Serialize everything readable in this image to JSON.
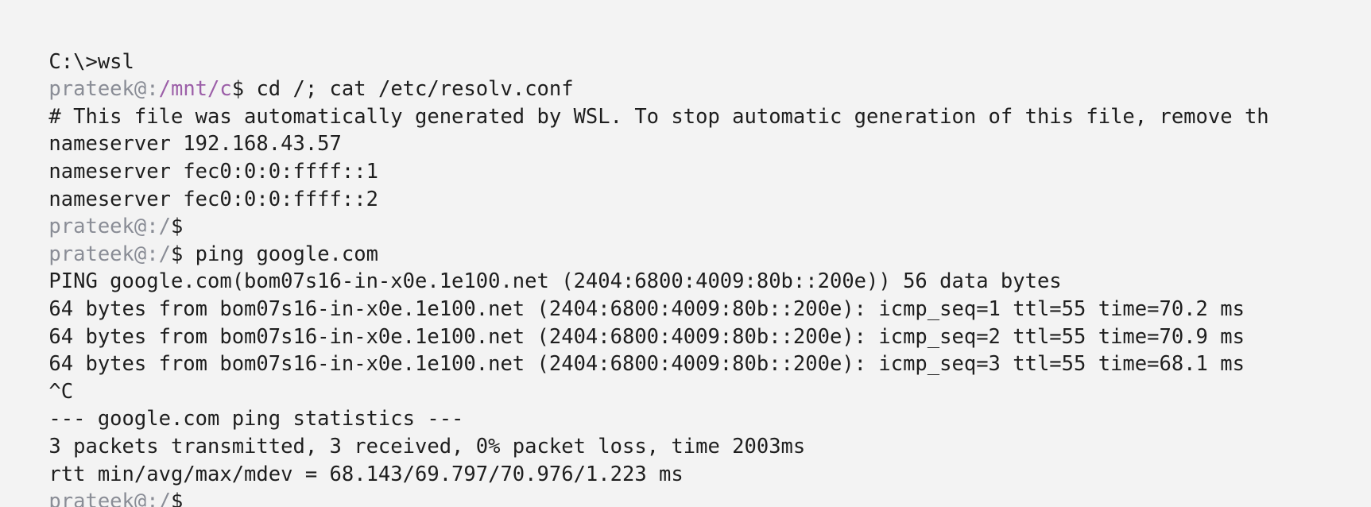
{
  "terminal": {
    "colors": {
      "background": "#f3f3f3",
      "text": "#1e1e1e",
      "prompt_user": "#8a8d96",
      "prompt_path": "#9c5fa8"
    },
    "lines": [
      {
        "type": "plain",
        "text": "C:\\>wsl"
      },
      {
        "type": "prompt",
        "user": "prateek",
        "at": "@:",
        "path": "/mnt/c",
        "sym": "$",
        "cmd": " cd /; cat /etc/resolv.conf"
      },
      {
        "type": "plain",
        "text": "# This file was automatically generated by WSL. To stop automatic generation of this file, remove th"
      },
      {
        "type": "plain",
        "text": "nameserver 192.168.43.57"
      },
      {
        "type": "plain",
        "text": "nameserver fec0:0:0:ffff::1"
      },
      {
        "type": "plain",
        "text": "nameserver fec0:0:0:ffff::2"
      },
      {
        "type": "prompt",
        "user": "prateek",
        "at": "@:",
        "path": "/",
        "sym": "$",
        "cmd": ""
      },
      {
        "type": "prompt",
        "user": "prateek",
        "at": "@:",
        "path": "/",
        "sym": "$",
        "cmd": " ping google.com"
      },
      {
        "type": "plain",
        "text": "PING google.com(bom07s16-in-x0e.1e100.net (2404:6800:4009:80b::200e)) 56 data bytes"
      },
      {
        "type": "plain",
        "text": "64 bytes from bom07s16-in-x0e.1e100.net (2404:6800:4009:80b::200e): icmp_seq=1 ttl=55 time=70.2 ms"
      },
      {
        "type": "plain",
        "text": "64 bytes from bom07s16-in-x0e.1e100.net (2404:6800:4009:80b::200e): icmp_seq=2 ttl=55 time=70.9 ms"
      },
      {
        "type": "plain",
        "text": "64 bytes from bom07s16-in-x0e.1e100.net (2404:6800:4009:80b::200e): icmp_seq=3 ttl=55 time=68.1 ms"
      },
      {
        "type": "plain",
        "text": "^C"
      },
      {
        "type": "plain",
        "text": "--- google.com ping statistics ---"
      },
      {
        "type": "plain",
        "text": "3 packets transmitted, 3 received, 0% packet loss, time 2003ms"
      },
      {
        "type": "plain",
        "text": "rtt min/avg/max/mdev = 68.143/69.797/70.976/1.223 ms"
      },
      {
        "type": "prompt",
        "user": "prateek",
        "at": "@:",
        "path": "/",
        "sym": "$",
        "cmd": ""
      }
    ]
  }
}
